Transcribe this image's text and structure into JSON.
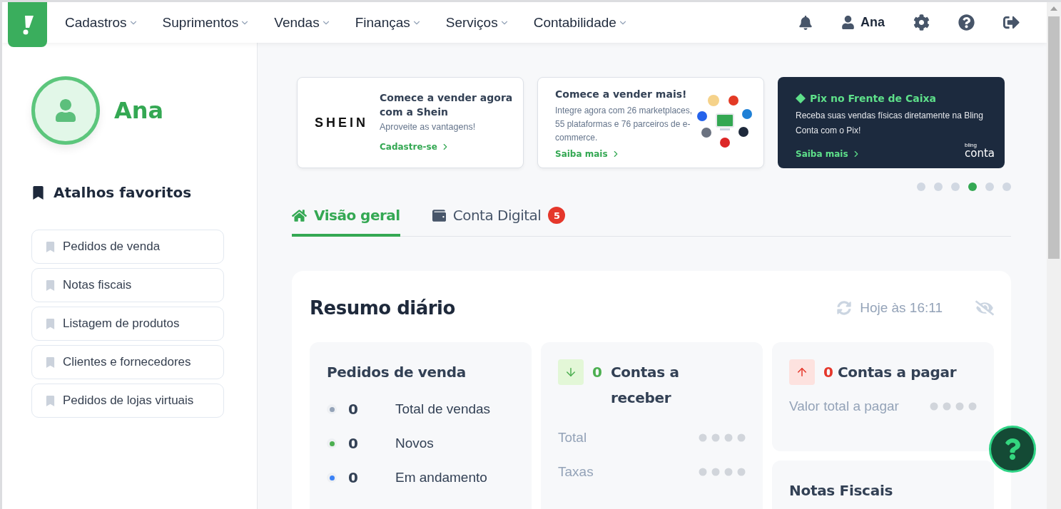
{
  "nav": {
    "menus": [
      {
        "label": "Cadastros"
      },
      {
        "label": "Suprimentos"
      },
      {
        "label": "Vendas"
      },
      {
        "label": "Finanças"
      },
      {
        "label": "Serviços"
      },
      {
        "label": "Contabilidade"
      }
    ],
    "user": "Ana"
  },
  "sidebar": {
    "name": "Ana",
    "favorites_title": "Atalhos favoritos",
    "favorites": [
      "Pedidos de venda",
      "Notas fiscais",
      "Listagem de produtos",
      "Clientes e fornecedores",
      "Pedidos de lojas virtuais"
    ]
  },
  "banners": [
    {
      "kind": "shein",
      "logo": "SHEIN",
      "title": "Comece a vender agora com a Shein",
      "text": "Aproveite as vantagens!",
      "link": "Cadastre-se"
    },
    {
      "kind": "marketplaces",
      "title": "Comece a vender mais!",
      "text": "Integre agora com 26 marketplaces, 55 plataformas e 76 parceiros de e-commerce.",
      "link": "Saiba mais"
    },
    {
      "kind": "pix",
      "title": "Pix no Frente de Caixa",
      "text": "Receba suas vendas físicas diretamente na Bling Conta com o Pix!",
      "link": "Saiba mais",
      "logo_top": "bling",
      "logo_bottom": "conta"
    }
  ],
  "carousel_dots": [
    {
      "selected": false
    },
    {
      "selected": false
    },
    {
      "selected": false
    },
    {
      "selected": true
    },
    {
      "selected": false
    },
    {
      "selected": false
    }
  ],
  "tabs": [
    {
      "label": "Visão geral",
      "selected": true,
      "kind": "home"
    },
    {
      "label": "Conta Digital",
      "selected": false,
      "kind": "wallet",
      "badge": "5"
    }
  ],
  "summary": {
    "title": "Resumo diário",
    "updated": "Hoje às 16:11",
    "orders": {
      "title": "Pedidos de venda",
      "rows": [
        {
          "count": "0",
          "label": "Total de vendas",
          "color": "#94a3b8"
        },
        {
          "count": "0",
          "label": "Novos",
          "color": "#4caf50"
        },
        {
          "count": "0",
          "label": "Em andamento",
          "color": "#3b82f6"
        }
      ]
    },
    "receivable": {
      "kind": "in",
      "count": "0",
      "title": "Contas a receber",
      "rows": [
        "Total",
        "Taxas"
      ]
    },
    "payable": {
      "kind": "out",
      "count": "0",
      "title": "Contas a pagar",
      "rows": [
        "Valor total a pagar"
      ]
    },
    "invoices": {
      "title": "Notas Fiscais"
    }
  }
}
